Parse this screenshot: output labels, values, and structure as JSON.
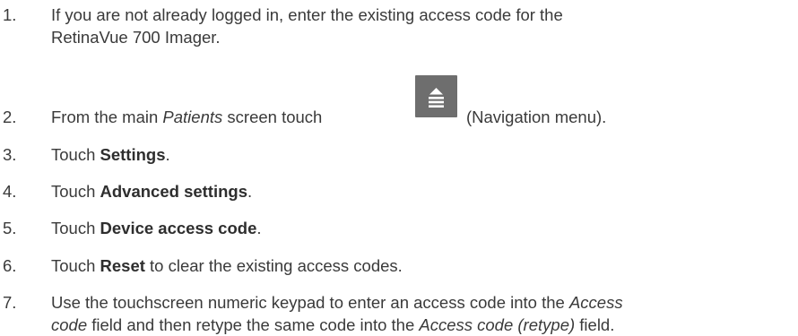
{
  "steps": [
    {
      "number": "1.",
      "line1": "If you are not already logged in, enter the existing access code for the",
      "line2": "RetinaVue 700 Imager."
    },
    {
      "number": "2.",
      "prefix": "From the main ",
      "emph": "Patients",
      "middle": " screen touch",
      "icon": "navigation-menu-icon",
      "suffix": "(Navigation menu)."
    },
    {
      "number": "3.",
      "prefix": "Touch ",
      "bold": "Settings",
      "suffix": "."
    },
    {
      "number": "4.",
      "prefix": "Touch ",
      "bold": "Advanced settings",
      "suffix": "."
    },
    {
      "number": "5.",
      "prefix": "Touch ",
      "bold": "Device access code",
      "suffix": "."
    },
    {
      "number": "6.",
      "prefix": "Touch ",
      "bold": "Reset",
      "suffix": " to clear the existing access codes."
    },
    {
      "number": "7.",
      "line1a": "Use the touchscreen numeric keypad to enter an access code into the ",
      "line1em": "Access",
      "line2em": "code",
      "line2a": " field and then retype the same code into the ",
      "line2em2": "Access code (retype)",
      "line2b": " field."
    }
  ],
  "colors": {
    "text": "#3a3a3a",
    "icon_background": "#6e6e6e",
    "icon_glyph": "#ffffff"
  }
}
